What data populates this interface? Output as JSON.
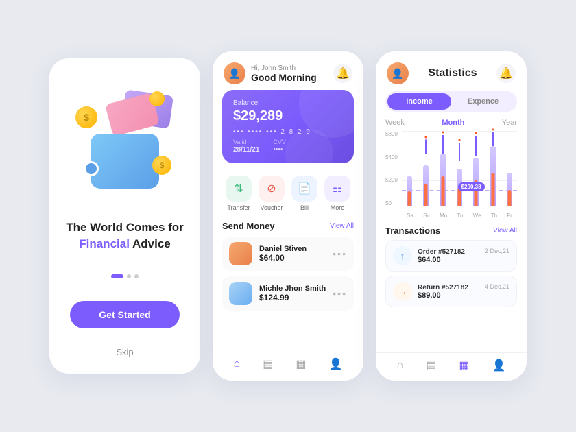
{
  "background": "#e8eaf0",
  "screen1": {
    "tagline_line1": "The World Comes for",
    "tagline_line2": "Financial",
    "tagline_line3": "Advice",
    "cta_label": "Get Started",
    "skip_label": "Skip"
  },
  "screen2": {
    "greeting_hi": "Hi, John Smith",
    "greeting_morning": "Good Morning",
    "balance_label": "Balance",
    "balance_amount": "$29,289",
    "card_dots": "•••  ••••  •••  2 8 2 9",
    "valid_label": "Valid",
    "valid_value": "28/11/21",
    "cvv_label": "CVV",
    "cvv_value": "••••",
    "actions": [
      {
        "label": "Transfer",
        "icon": "⇅"
      },
      {
        "label": "Voucher",
        "icon": "⊘"
      },
      {
        "label": "Bill",
        "icon": "📄"
      },
      {
        "label": "More",
        "icon": "⚏"
      }
    ],
    "send_money_title": "Send Money",
    "view_all_label": "View All",
    "contacts": [
      {
        "name": "Daniel Stiven",
        "amount": "$64.00"
      },
      {
        "name": "Michle Jhon Smith",
        "amount": "$124.99"
      }
    ]
  },
  "screen3": {
    "title": "Statistics",
    "toggle_income": "Income",
    "toggle_expense": "Expence",
    "periods": [
      "Week",
      "Month",
      "Year"
    ],
    "active_period": "Month",
    "chart_y_labels": [
      "$800",
      "$400",
      "$200",
      "$0"
    ],
    "chart_x_labels": [
      "Sa",
      "Su",
      "Mo",
      "Tu",
      "We",
      "Th",
      "Fr"
    ],
    "price_tag_value": "$200.38",
    "transactions_title": "Transactions",
    "view_all_label": "View All",
    "transactions": [
      {
        "id": "Order #527182",
        "amount": "$64.00",
        "date": "2 Dec,21",
        "type": "up"
      },
      {
        "id": "Return #527182",
        "amount": "$89.00",
        "date": "4 Dec,21",
        "type": "right"
      }
    ]
  }
}
